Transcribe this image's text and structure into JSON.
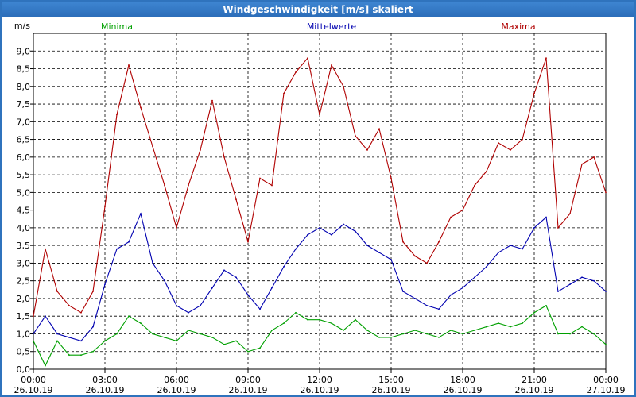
{
  "window": {
    "title": "Windgeschwindigkeit [m/s] skaliert"
  },
  "chart_data": {
    "type": "line",
    "title": "Windgeschwindigkeit [m/s] skaliert",
    "ylabel": "m/s",
    "ylim": [
      0,
      9.5
    ],
    "yticks": [
      "0,0",
      "0,5",
      "1,0",
      "1,5",
      "2,0",
      "2,5",
      "3,0",
      "3,5",
      "4,0",
      "4,5",
      "5,0",
      "5,5",
      "6,0",
      "6,5",
      "7,0",
      "7,5",
      "8,0",
      "8,5",
      "9,0"
    ],
    "xlim": [
      0,
      24
    ],
    "xticks": [
      {
        "time": "00:00",
        "date": "26.10.19"
      },
      {
        "time": "03:00",
        "date": "26.10.19"
      },
      {
        "time": "06:00",
        "date": "26.10.19"
      },
      {
        "time": "09:00",
        "date": "26.10.19"
      },
      {
        "time": "12:00",
        "date": "26.10.19"
      },
      {
        "time": "15:00",
        "date": "26.10.19"
      },
      {
        "time": "18:00",
        "date": "26.10.19"
      },
      {
        "time": "21:00",
        "date": "26.10.19"
      },
      {
        "time": "00:00",
        "date": "27.10.19"
      }
    ],
    "grid": true,
    "legend": "top",
    "series": [
      {
        "name": "Minima",
        "color": "#00a000",
        "x": [
          0,
          0.5,
          1,
          1.5,
          2,
          2.5,
          3,
          3.5,
          4,
          4.5,
          5,
          5.5,
          6,
          6.5,
          7,
          7.5,
          8,
          8.5,
          9,
          9.5,
          10,
          10.5,
          11,
          11.5,
          12,
          12.5,
          13,
          13.5,
          14,
          14.5,
          15,
          15.5,
          16,
          16.5,
          17,
          17.5,
          18,
          18.5,
          19,
          19.5,
          20,
          20.5,
          21,
          21.5,
          22,
          22.5,
          23,
          23.5,
          24
        ],
        "values": [
          0.8,
          0.1,
          0.8,
          0.4,
          0.4,
          0.5,
          0.8,
          1.0,
          1.5,
          1.3,
          1.0,
          0.9,
          0.8,
          1.1,
          1.0,
          0.9,
          0.7,
          0.8,
          0.5,
          0.6,
          1.1,
          1.3,
          1.6,
          1.4,
          1.4,
          1.3,
          1.1,
          1.4,
          1.1,
          0.9,
          0.9,
          1.0,
          1.1,
          1.0,
          0.9,
          1.1,
          1.0,
          1.1,
          1.2,
          1.3,
          1.2,
          1.3,
          1.6,
          1.8,
          1.0,
          1.0,
          1.2,
          1.0,
          0.7
        ]
      },
      {
        "name": "Mittelwerte",
        "color": "#0000b0",
        "x": [
          0,
          0.5,
          1,
          1.5,
          2,
          2.5,
          3,
          3.5,
          4,
          4.5,
          5,
          5.5,
          6,
          6.5,
          7,
          7.5,
          8,
          8.5,
          9,
          9.5,
          10,
          10.5,
          11,
          11.5,
          12,
          12.5,
          13,
          13.5,
          14,
          14.5,
          15,
          15.5,
          16,
          16.5,
          17,
          17.5,
          18,
          18.5,
          19,
          19.5,
          20,
          20.5,
          21,
          21.5,
          22,
          22.5,
          23,
          23.5,
          24
        ],
        "values": [
          1.0,
          1.5,
          1.0,
          0.9,
          0.8,
          1.2,
          2.4,
          3.4,
          3.6,
          4.4,
          3.0,
          2.5,
          1.8,
          1.6,
          1.8,
          2.3,
          2.8,
          2.6,
          2.1,
          1.7,
          2.3,
          2.9,
          3.4,
          3.8,
          4.0,
          3.8,
          4.1,
          3.9,
          3.5,
          3.3,
          3.1,
          2.2,
          2.0,
          1.8,
          1.7,
          2.1,
          2.3,
          2.6,
          2.9,
          3.3,
          3.5,
          3.4,
          4.0,
          4.3,
          2.2,
          2.4,
          2.6,
          2.5,
          2.2
        ]
      },
      {
        "name": "Maxima",
        "color": "#b00000",
        "x": [
          0,
          0.5,
          1,
          1.5,
          2,
          2.5,
          3,
          3.5,
          4,
          4.5,
          5,
          5.5,
          6,
          6.5,
          7,
          7.5,
          8,
          8.5,
          9,
          9.5,
          10,
          10.5,
          11,
          11.5,
          12,
          12.5,
          13,
          13.5,
          14,
          14.5,
          15,
          15.5,
          16,
          16.5,
          17,
          17.5,
          18,
          18.5,
          19,
          19.5,
          20,
          20.5,
          21,
          21.5,
          22,
          22.5,
          23,
          23.5,
          24
        ],
        "values": [
          1.5,
          3.4,
          2.2,
          1.8,
          1.6,
          2.2,
          4.6,
          7.2,
          8.6,
          7.4,
          6.3,
          5.2,
          4.0,
          5.2,
          6.2,
          7.6,
          6.0,
          4.8,
          3.6,
          5.4,
          5.2,
          7.8,
          8.4,
          8.8,
          7.2,
          8.6,
          8.0,
          6.6,
          6.2,
          6.8,
          5.4,
          3.6,
          3.2,
          3.0,
          3.6,
          4.3,
          4.5,
          5.2,
          5.6,
          6.4,
          6.2,
          6.5,
          7.8,
          8.8,
          4.0,
          4.4,
          5.8,
          6.0,
          5.0
        ]
      }
    ]
  }
}
